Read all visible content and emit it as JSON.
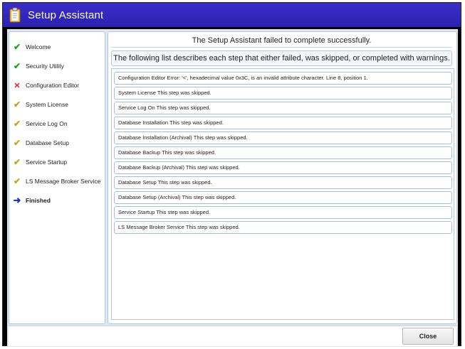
{
  "window": {
    "title": "Setup Assistant",
    "icon": "clipboard-icon"
  },
  "sidebar": {
    "items": [
      {
        "label": "Welcome",
        "status": "done",
        "icon": "checkmark-icon"
      },
      {
        "label": "Security Utility",
        "status": "done",
        "icon": "checkmark-icon"
      },
      {
        "label": "Configuration Editor",
        "status": "error",
        "icon": "x-icon"
      },
      {
        "label": "System License",
        "status": "warning",
        "icon": "checkmark-icon"
      },
      {
        "label": "Service Log On",
        "status": "warning",
        "icon": "checkmark-icon"
      },
      {
        "label": "Database Setup",
        "status": "warning",
        "icon": "checkmark-icon"
      },
      {
        "label": "Service Startup",
        "status": "warning",
        "icon": "checkmark-icon"
      },
      {
        "label": "LS Message Broker Service",
        "status": "warning",
        "icon": "checkmark-icon"
      },
      {
        "label": "Finished",
        "status": "current",
        "icon": "arrow-right-icon"
      }
    ]
  },
  "main": {
    "heading": "The Setup Assistant failed to complete successfully.",
    "subheading": "The following list describes each step that either failed, was skipped, or completed with warnings.",
    "results": [
      "Configuration Editor   Error: '<', hexadecimal value 0x3C, is an invalid attribute character. Line 8, position 1.",
      "System License   This step was skipped.",
      "Service Log On   This step was skipped.",
      "Database Installation   This step was skipped.",
      "Database Installation (Archival)   This step was skipped.",
      "Database Backup    This step was skipped.",
      "Database Backup (Archival)   This step was skipped.",
      "Database Setup   This step was skipped.",
      "Database Setup (Archival)   This step was skipped.",
      "Service Startup   This step was skipped.",
      "LS Message Broker Service   This step was skipped."
    ]
  },
  "footer": {
    "close_label": "Close"
  },
  "colors": {
    "titlebar": "#2e24b8",
    "done": "#1ea11e",
    "error": "#d42a1e",
    "warning": "#c9a21a",
    "current": "#1c35c8"
  }
}
